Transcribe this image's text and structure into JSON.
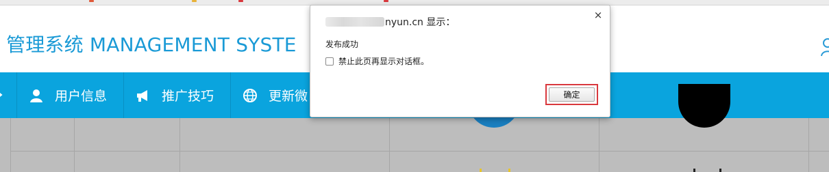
{
  "colors": {
    "brand_blue": "#0aa4de",
    "header_bg": "#ffffff",
    "title_color": "#1a9ad6",
    "content_gray": "#bdbdbd",
    "focus_outline": "#d9383d"
  },
  "header": {
    "title": "管理系统 MANAGEMENT SYSTE",
    "user_icon": "user-icon"
  },
  "nav": {
    "items": [
      {
        "label": "用户信息",
        "icon": "user-icon"
      },
      {
        "label": "推广技巧",
        "icon": "megaphone-icon"
      },
      {
        "label": "更新微",
        "icon": "globe-icon"
      }
    ]
  },
  "dialog": {
    "origin_suffix": "nyun.cn 显示：",
    "message": "发布成功",
    "checkbox_label": "禁止此页再显示对话框。",
    "checkbox_checked": false,
    "ok_label": "确定",
    "close_glyph": "×"
  }
}
